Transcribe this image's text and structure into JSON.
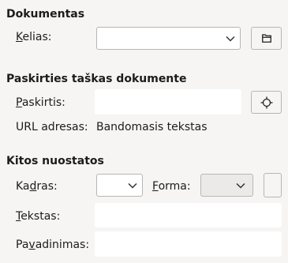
{
  "document": {
    "title": "Dokumentas",
    "path_label_prefix": "",
    "path_label_mnemonic": "K",
    "path_label_rest": "elias:",
    "path_value": ""
  },
  "target": {
    "title": "Paskirties taškas dokumente",
    "target_label_mnemonic": "P",
    "target_label_rest": "askirtis:",
    "target_value": "",
    "url_label": "URL adresas:",
    "url_value": "Bandomasis tekstas"
  },
  "other": {
    "title": "Kitos nuostatos",
    "frame_label_prefix": "Ka",
    "frame_label_mnemonic": "d",
    "frame_label_rest": "ras:",
    "frame_value": "",
    "form_label_mnemonic": "F",
    "form_label_rest": "orma:",
    "form_value": "",
    "text_label_mnemonic": "T",
    "text_label_rest": "ekstas:",
    "text_value": "",
    "name_label_prefix": "Pa",
    "name_label_mnemonic": "v",
    "name_label_rest": "adinimas:",
    "name_value": ""
  },
  "icons": {
    "browse": "folder-icon",
    "target_picker": "crosshair-icon"
  }
}
